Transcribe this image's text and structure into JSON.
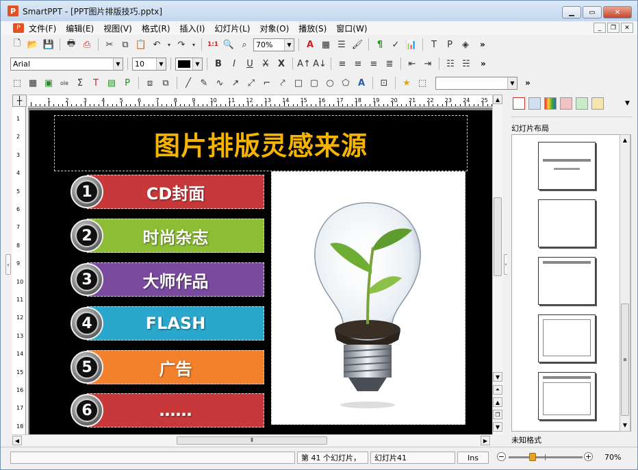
{
  "window": {
    "app": "SmartPPT",
    "title": "SmartPPT - [PPT图片排版技巧.pptx]"
  },
  "menu": [
    "文件(F)",
    "编辑(E)",
    "视图(V)",
    "格式(R)",
    "插入(I)",
    "幻灯片(L)",
    "对象(O)",
    "播放(S)",
    "窗口(W)"
  ],
  "toolbar": {
    "zoom_value": "70%",
    "font_name": "Arial",
    "font_size": "10",
    "more": "»"
  },
  "ruler": {
    "h": [
      "1",
      "2",
      "3",
      "4",
      "5",
      "6",
      "7",
      "8",
      "9",
      "10",
      "11",
      "12",
      "13",
      "14",
      "15",
      "16",
      "17",
      "18",
      "19",
      "20",
      "21",
      "22",
      "23",
      "24",
      "25"
    ],
    "v": [
      "1",
      "2",
      "3",
      "4",
      "5",
      "6",
      "7",
      "8",
      "9",
      "10",
      "11",
      "12",
      "13",
      "14",
      "15",
      "16",
      "17",
      "18"
    ]
  },
  "slide": {
    "title": "图片排版灵感来源",
    "title_color": "#f5b400",
    "items": [
      {
        "num": "1",
        "label": "CD封面",
        "color": "#c8383a"
      },
      {
        "num": "2",
        "label": "时尚杂志",
        "color": "#8cbd35"
      },
      {
        "num": "3",
        "label": "大师作品",
        "color": "#7a4a9e"
      },
      {
        "num": "4",
        "label": "FLASH",
        "color": "#2aa7cc"
      },
      {
        "num": "5",
        "label": "广告",
        "color": "#f3802a"
      },
      {
        "num": "6",
        "label": "……",
        "color": "#c8383a"
      }
    ]
  },
  "panel": {
    "title": "幻灯片布局",
    "footer": "未知格式"
  },
  "status": {
    "slide_count": "第 41 个幻灯片，",
    "slide_name": "幻灯片41",
    "mode": "Ins",
    "zoom": "70%"
  }
}
